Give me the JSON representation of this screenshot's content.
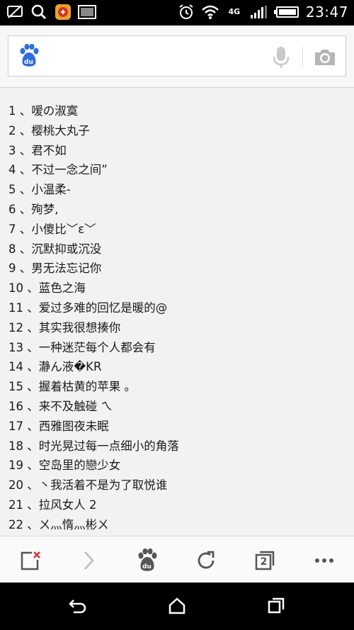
{
  "status_bar": {
    "time": "23:47",
    "network_label": "4G",
    "left_icons": [
      "cast-off-icon",
      "search-icon",
      "app-notification-icon",
      "gallery-icon"
    ],
    "right_icons": [
      "alarm-icon",
      "wifi-icon",
      "4g-icon",
      "signal-icon",
      "battery-icon"
    ]
  },
  "search": {
    "value": "",
    "placeholder": ""
  },
  "list": [
    "1 、嗳の淑寞",
    "2 、樱桃大丸子",
    "3 、君不如",
    "4 、不过一念之间”",
    "5 、小温柔-",
    "6 、殉梦,",
    "7 、小傻比﹀ε﹀",
    "8 、沉默抑或沉没",
    "9 、男无法忘记你",
    "10 、蓝色之海",
    "11 、爱过多难的回忆是暖的@",
    "12 、其实我很想揍你",
    "13 、一种迷茫每个人都会有",
    "14 、瀞ん液�KR",
    "15 、握着枯黄的苹果 。",
    "16 、来不及触碰 ㄟ",
    "17 、西雅图夜未眠",
    "18 、时光晃过每一点细小的角落",
    "19 、空岛里的戀少女",
    "20 、丶我活着不是为了取悦谁",
    "21 、拉风女人 2",
    "22 、ㄨ灬惰灬彬ㄨ"
  ],
  "toolbar": {
    "tab_count": "2",
    "buttons": [
      "close-page-icon",
      "forward-icon",
      "baidu-home-icon",
      "refresh-icon",
      "tabs-icon",
      "more-icon"
    ]
  },
  "navbar": {
    "buttons": [
      "back-icon",
      "home-icon",
      "recents-icon"
    ]
  },
  "colors": {
    "status_bar_bg": "#000000",
    "baidu_blue": "#2f6fd9",
    "list_text": "#1a1a1a",
    "background": "#f2f2f2"
  }
}
